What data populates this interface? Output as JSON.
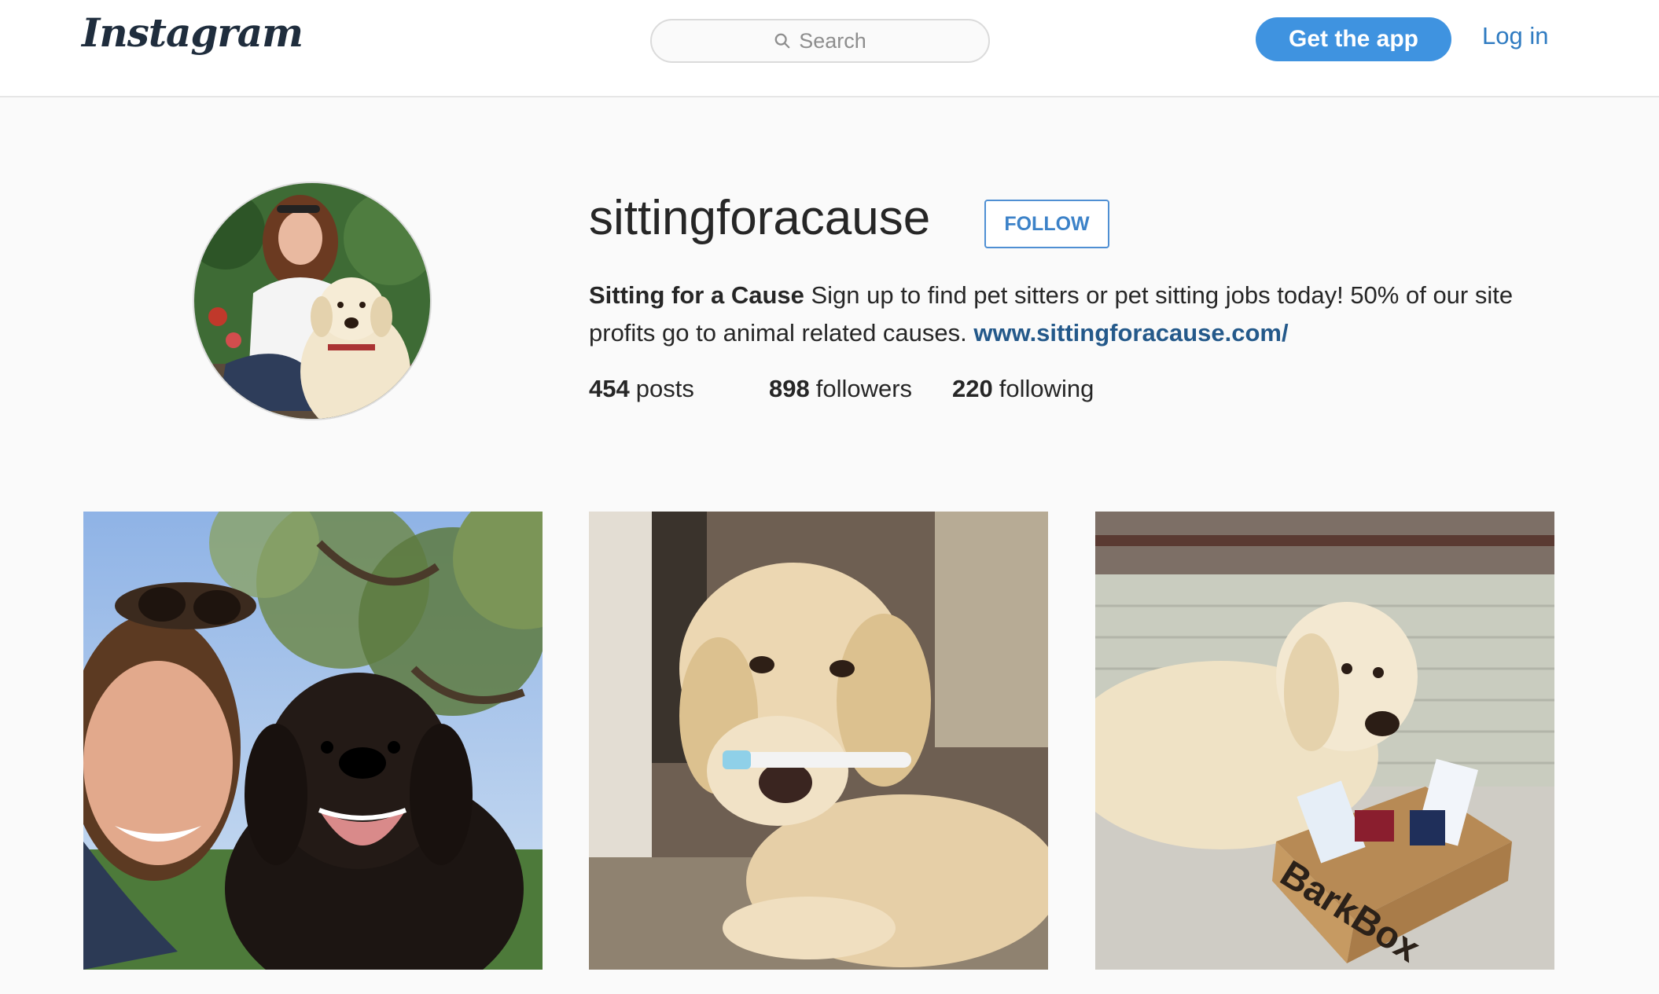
{
  "header": {
    "logo_text": "Instagram",
    "search_placeholder": "Search",
    "get_app_label": "Get the app",
    "login_label": "Log in",
    "accent_color": "#3f93e0"
  },
  "profile": {
    "username": "sittingforacause",
    "follow_label": "FOLLOW",
    "full_name": "Sitting for a Cause",
    "bio": " Sign up to find pet sitters or pet sitting jobs today! 50% of our site profits go to animal related causes. ",
    "website": "www.sittingforacause.com/",
    "stats": {
      "posts_count": "454",
      "posts_label": "posts",
      "followers_count": "898",
      "followers_label": "followers",
      "following_count": "220",
      "following_label": "following"
    }
  },
  "posts": [
    {
      "subject": "woman-selfie-with-black-labrador"
    },
    {
      "subject": "golden-retriever-with-toothbrush"
    },
    {
      "subject": "golden-retriever-with-barkbox",
      "box_text": "BarkBox"
    }
  ]
}
